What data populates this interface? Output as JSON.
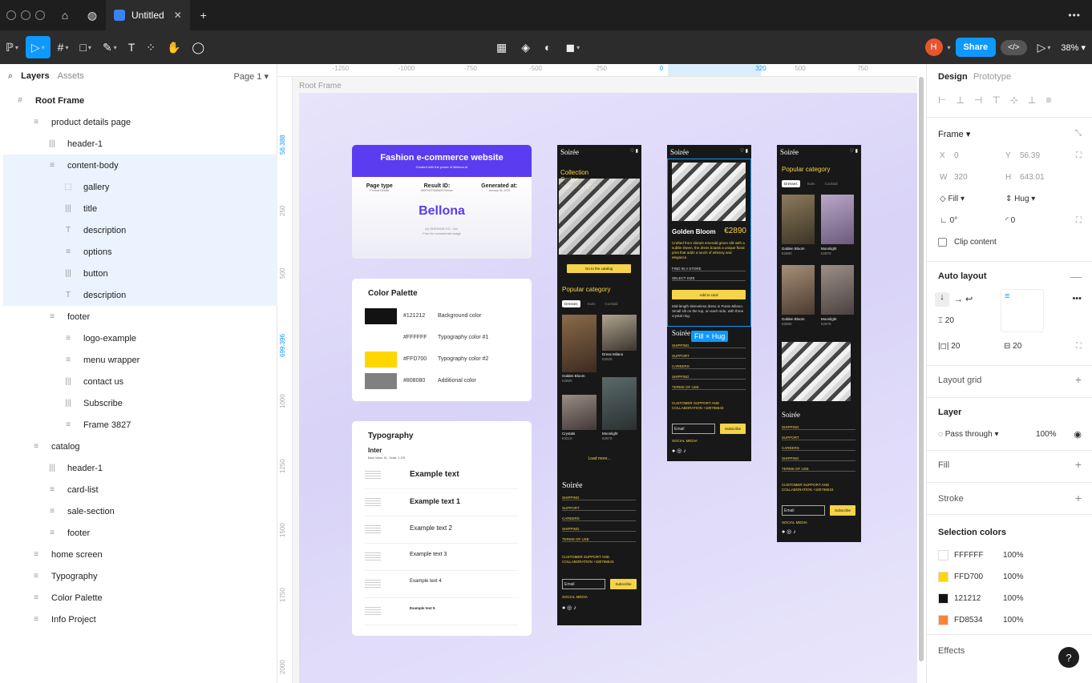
{
  "tab": {
    "title": "Untitled"
  },
  "toolbar": {
    "avatar": "H",
    "share": "Share",
    "code": "</>",
    "zoom": "38%"
  },
  "left_panel": {
    "tabs": {
      "layers": "Layers",
      "assets": "Assets"
    },
    "page": "Page 1",
    "layers": [
      {
        "label": "Root Frame",
        "depth": 0,
        "icon": "#"
      },
      {
        "label": "product details page",
        "depth": 1,
        "icon": "≡"
      },
      {
        "label": "header-1",
        "depth": 2,
        "icon": "|||"
      },
      {
        "label": "content-body",
        "depth": 2,
        "icon": "≡"
      },
      {
        "label": "gallery",
        "depth": 3,
        "icon": "⬚"
      },
      {
        "label": "title",
        "depth": 3,
        "icon": "|||"
      },
      {
        "label": "description",
        "depth": 3,
        "icon": "T"
      },
      {
        "label": "options",
        "depth": 3,
        "icon": "≡"
      },
      {
        "label": "button",
        "depth": 3,
        "icon": "|||"
      },
      {
        "label": "description",
        "depth": 3,
        "icon": "T"
      },
      {
        "label": "footer",
        "depth": 2,
        "icon": "≡"
      },
      {
        "label": "logo-example",
        "depth": 3,
        "icon": "≡"
      },
      {
        "label": "menu wrapper",
        "depth": 3,
        "icon": "≡"
      },
      {
        "label": "contact us",
        "depth": 3,
        "icon": "|||"
      },
      {
        "label": "Subscribe",
        "depth": 3,
        "icon": "|||"
      },
      {
        "label": "Frame 3827",
        "depth": 3,
        "icon": "≡"
      },
      {
        "label": "catalog",
        "depth": 1,
        "icon": "≡"
      },
      {
        "label": "header-1",
        "depth": 2,
        "icon": "|||"
      },
      {
        "label": "card-list",
        "depth": 2,
        "icon": "≡"
      },
      {
        "label": "sale-section",
        "depth": 2,
        "icon": "≡"
      },
      {
        "label": "footer",
        "depth": 2,
        "icon": "≡"
      },
      {
        "label": "home screen",
        "depth": 1,
        "icon": "≡"
      },
      {
        "label": "Typography",
        "depth": 1,
        "icon": "≡"
      },
      {
        "label": "Color Palette",
        "depth": 1,
        "icon": "≡"
      },
      {
        "label": "Info Project",
        "depth": 1,
        "icon": "≡"
      }
    ]
  },
  "ruler": {
    "top": [
      "-1250",
      "-1000",
      "-750",
      "-500",
      "-250",
      "0",
      "320",
      "500",
      "750"
    ],
    "left": [
      "56.388",
      "250",
      "500",
      "699.396",
      "1000",
      "1250",
      "1500",
      "1750",
      "2000"
    ]
  },
  "canvas": {
    "root_label": "Root Frame",
    "info_card": {
      "title": "Fashion e-commerce website",
      "subtitle": "Created with the power of Bellona AI",
      "cols": [
        {
          "head": "Page type",
          "val": "Product Details"
        },
        {
          "head": "Result ID:",
          "val": "6657b2f7f0a5a0679cfcae"
        },
        {
          "head": "Generated at:",
          "val": "January 06, 2024"
        }
      ],
      "brand": "Bellona",
      "copyright": "(c) ODESIGN CO., Ltd.",
      "license": "Free for commercial usage"
    },
    "palette": {
      "title": "Color Palette",
      "items": [
        {
          "hex": "#121212",
          "name": "Background color",
          "color": "#121212"
        },
        {
          "hex": "#FFFFFF",
          "name": "Typography color #1",
          "color": "#FFFFFF"
        },
        {
          "hex": "#FFD700",
          "name": "Typography color #2",
          "color": "#FFD700"
        },
        {
          "hex": "#808080",
          "name": "Additional color",
          "color": "#808080"
        }
      ]
    },
    "typography": {
      "title": "Typography",
      "font": "Inter",
      "meta": "Base Value: 16 · Scale: 1.125",
      "examples": [
        "Example text",
        "Example text 1",
        "Example text 2",
        "Example text 3",
        "Example text 4",
        "Example text 5"
      ]
    },
    "mobile1": {
      "logo": "Soirée",
      "hero": "Collection Spring-Summer 2024",
      "cta": "Go to the catalog",
      "popular": "Popular category",
      "chips": [
        "Dresses",
        "Suits",
        "Cocktail"
      ],
      "products": [
        {
          "name": "Golden Bloom",
          "price": "€2890"
        },
        {
          "name": "Dress Milano",
          "price": "€2525"
        },
        {
          "name": "Crystals",
          "price": "€3210"
        },
        {
          "name": "Moonlight",
          "price": "€2879"
        }
      ],
      "load_more": "Load more...",
      "links": [
        "SHIPPING",
        "SUPPORT",
        "CAREERS",
        "SHIPPING",
        "TERMS OF USE"
      ],
      "support": "CUSTOMER SUPPORT AND COLLABORATION +180796543",
      "email": "Email",
      "subscribe": "Subscribe",
      "social": "SOCIAL MEDIA"
    },
    "mobile2": {
      "logo": "Soirée",
      "name": "Golden Bloom",
      "price": "€2890",
      "desc": "Crafted from vibrant emerald green silk with a subtle sheen, the dress boasts a unique floral print that adds a touch of whimsy and elegance.",
      "find": "FIND IN A STORE",
      "size": "SELECT SIZE",
      "add": "Add to card",
      "desc2": "Mid-length sleeveless dress in Punto Milano. Small slit on the top, on each side, with three crystal ring.",
      "badge": "Fill × Hug",
      "links": [
        "SHIPPING",
        "SUPPORT",
        "CAREERS",
        "SHIPPING",
        "TERMS OF USE"
      ],
      "support": "CUSTOMER SUPPORT AND COLLABORATION +180796543",
      "email": "Email",
      "subscribe": "Subscribe",
      "social": "SOCIAL MEDIA"
    },
    "mobile3": {
      "logo": "Soirée",
      "popular": "Popular category",
      "chips": [
        "Dresses",
        "Suits",
        "Cocktail"
      ],
      "products": [
        {
          "name": "Golden Bloom",
          "price": "€2890"
        },
        {
          "name": "Moonlight",
          "price": "€2879"
        },
        {
          "name": "Golden Bloom",
          "price": "€2890"
        },
        {
          "name": "Moonlight",
          "price": "€2879"
        }
      ],
      "links": [
        "SHIPPING",
        "SUPPORT",
        "CAREERS",
        "SHIPPING",
        "TERMS OF USE"
      ],
      "support": "CUSTOMER SUPPORT AND COLLABORATION +180796543",
      "email": "Email",
      "subscribe": "Subscribe",
      "social": "SOCIAL MEDIA"
    }
  },
  "right_panel": {
    "tabs": {
      "design": "Design",
      "prototype": "Prototype"
    },
    "frame": {
      "label": "Frame",
      "x_label": "X",
      "x": "0",
      "y_label": "Y",
      "y": "56.39",
      "w_label": "W",
      "w": "320",
      "h_label": "H",
      "h": "643.01",
      "w_mode": "Fill",
      "h_mode": "Hug",
      "rotation": "0°",
      "radius": "0",
      "clip": "Clip content"
    },
    "auto_layout": {
      "label": "Auto layout",
      "gap": "20",
      "pad_h": "20",
      "pad_v": "20"
    },
    "layout_grid": "Layout grid",
    "layer": {
      "label": "Layer",
      "blend": "Pass through",
      "opacity": "100%"
    },
    "fill": "Fill",
    "stroke": "Stroke",
    "selection_colors": {
      "label": "Selection colors",
      "items": [
        {
          "hex": "FFFFFF",
          "opacity": "100%",
          "color": "#FFFFFF"
        },
        {
          "hex": "FFD700",
          "opacity": "100%",
          "color": "#FFD700"
        },
        {
          "hex": "121212",
          "opacity": "100%",
          "color": "#121212"
        },
        {
          "hex": "FD8534",
          "opacity": "100%",
          "color": "#FD8534"
        }
      ]
    },
    "effects": "Effects"
  }
}
